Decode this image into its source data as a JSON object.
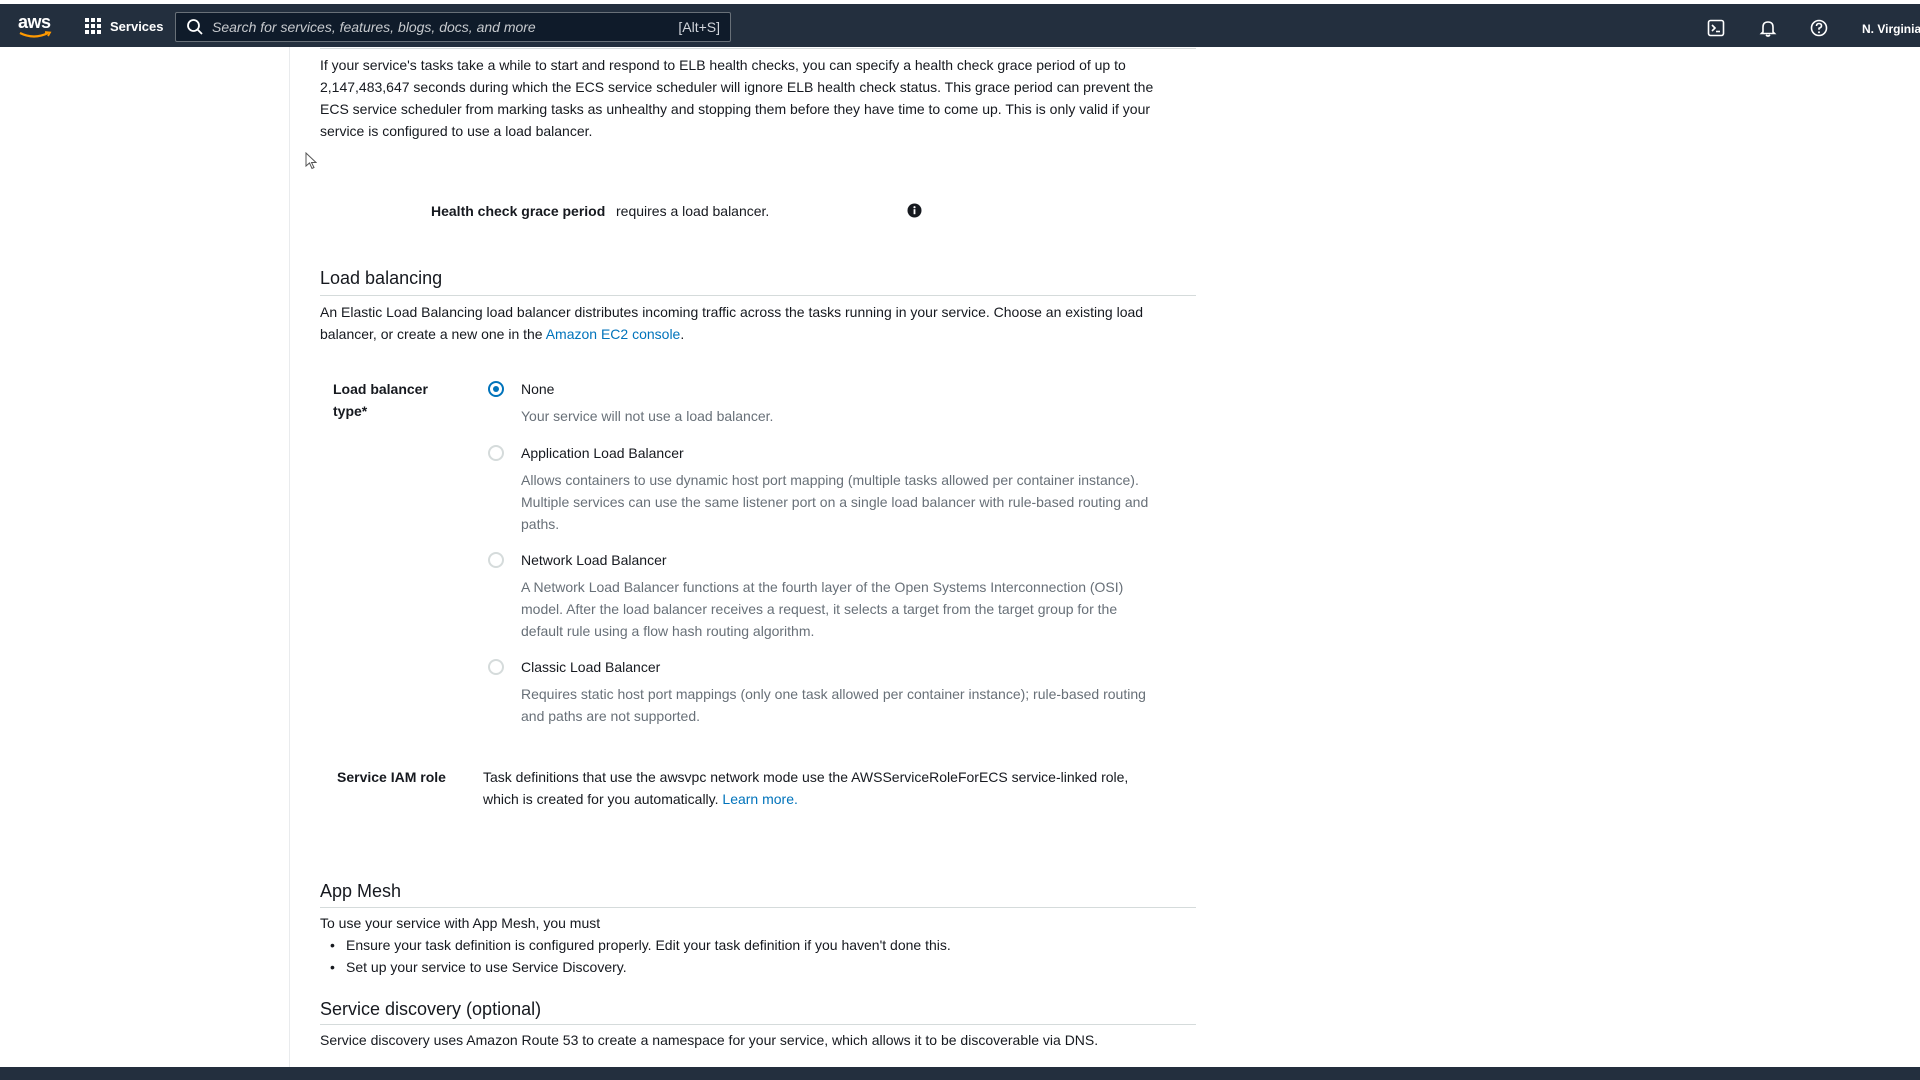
{
  "nav": {
    "logo_text": "aws",
    "services_label": "Services",
    "search_placeholder": "Search for services, features, blogs, docs, and more",
    "search_shortcut": "[Alt+S]",
    "region": "N. Virginia",
    "icons": [
      "cloudshell-icon",
      "bell-icon",
      "help-icon"
    ]
  },
  "grace": {
    "description": "If your service's tasks take a while to start and respond to ELB health checks, you can specify a health check grace period of up to 2,147,483,647 seconds during which the ECS service scheduler will ignore ELB health check status. This grace period can prevent the ECS service scheduler from marking tasks as unhealthy and stopping them before they have time to come up. This is only valid if your service is configured to use a load balancer.",
    "label": "Health check grace period",
    "value": "requires a load balancer."
  },
  "load_balancing": {
    "title": "Load balancing",
    "description_prefix": "An Elastic Load Balancing load balancer distributes incoming traffic across the tasks running in your service. Choose an existing load balancer, or create a new one in the ",
    "description_link": "Amazon EC2 console",
    "description_suffix": ".",
    "type_label": "Load balancer type*",
    "options": [
      {
        "label": "None",
        "description": "Your service will not use a load balancer.",
        "checked": true
      },
      {
        "label": "Application Load Balancer",
        "description": "Allows containers to use dynamic host port mapping (multiple tasks allowed per container instance). Multiple services can use the same listener port on a single load balancer with rule-based routing and paths.",
        "checked": false
      },
      {
        "label": "Network Load Balancer",
        "description": "A Network Load Balancer functions at the fourth layer of the Open Systems Interconnection (OSI) model. After the load balancer receives a request, it selects a target from the target group for the default rule using a flow hash routing algorithm.",
        "checked": false
      },
      {
        "label": "Classic Load Balancer",
        "description": "Requires static host port mappings (only one task allowed per container instance); rule-based routing and paths are not supported.",
        "checked": false
      }
    ],
    "iam_label": "Service IAM role",
    "iam_text": "Task definitions that use the awsvpc network mode use the AWSServiceRoleForECS service-linked role, which is created for you automatically. ",
    "iam_link": "Learn more."
  },
  "app_mesh": {
    "title": "App Mesh",
    "intro": "To use your service with App Mesh, you must",
    "bullets": [
      "Ensure your task definition is configured properly. Edit your task definition if you haven't done this.",
      "Set up your service to use Service Discovery."
    ]
  },
  "service_discovery": {
    "title": "Service discovery (optional)",
    "description": "Service discovery uses Amazon Route 53 to create a namespace for your service, which allows it to be discoverable via DNS."
  },
  "colors": {
    "nav_bg": "#232f3e",
    "link": "#0073bb",
    "muted": "#687078"
  }
}
